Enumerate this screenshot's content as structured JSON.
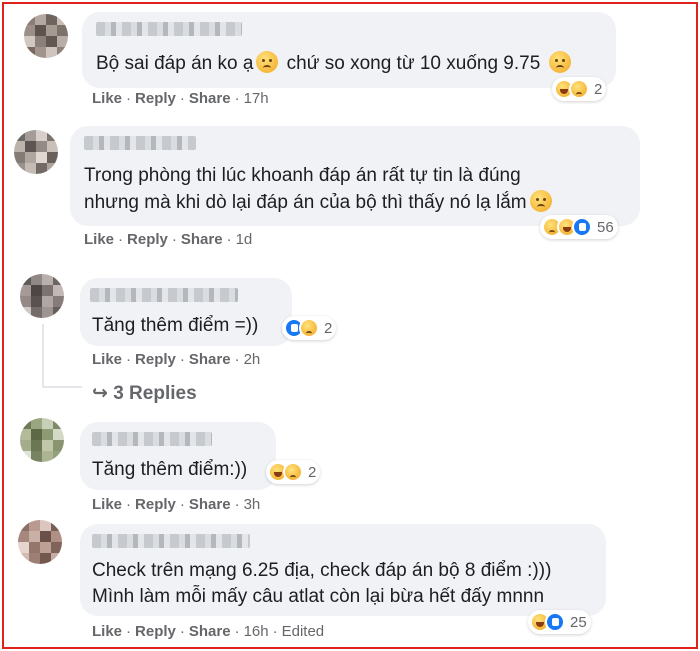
{
  "comments": [
    {
      "text_line1": "Bộ sai đáp án ko ạ",
      "text_line1b": "chứ so xong từ 10 xuống 9.75",
      "reaction_count": "2",
      "like": "Like",
      "reply": "Reply",
      "share": "Share",
      "time": "17h"
    },
    {
      "text_line1": "Trong phòng thi lúc khoanh đáp án rất tự tin là đúng",
      "text_line2": "nhưng mà khi dò lại đáp án của bộ thì thấy nó lạ lắm",
      "reaction_count": "56",
      "like": "Like",
      "reply": "Reply",
      "share": "Share",
      "time": "1d"
    },
    {
      "text_line1": "Tăng thêm điểm =))",
      "reaction_count": "2",
      "like": "Like",
      "reply": "Reply",
      "share": "Share",
      "time": "2h",
      "replies_label": "3 Replies"
    },
    {
      "text_line1": "Tăng thêm điểm:))",
      "reaction_count": "2",
      "like": "Like",
      "reply": "Reply",
      "share": "Share",
      "time": "3h"
    },
    {
      "text_line1": "Check trên mạng 6.25 địa, check đáp án bộ 8 điểm :)))",
      "text_line2": "Mình làm mỗi mấy câu atlat còn lại bừa hết đấy mnnn",
      "reaction_count": "25",
      "like": "Like",
      "reply": "Reply",
      "share": "Share",
      "time": "16h",
      "edited": "Edited"
    }
  ],
  "colors": {
    "frame_border": "#e0221e",
    "bubble": "#f0f2f5",
    "meta": "#65676b",
    "like_blue": "#1877f2"
  }
}
